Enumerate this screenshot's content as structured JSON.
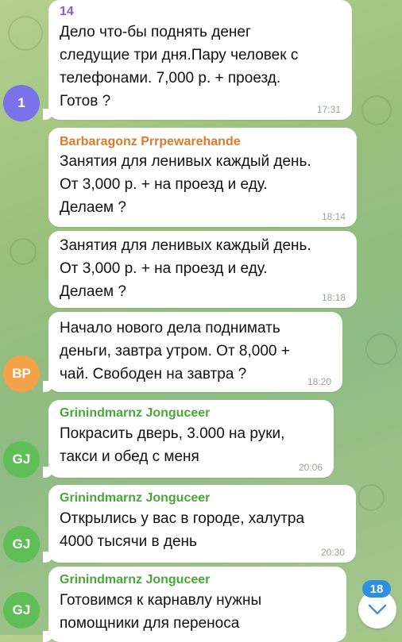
{
  "colors": {
    "sender_orange": "#d97b2a",
    "sender_green": "#4aa63a",
    "sender_purple": "#8e5cc9",
    "avatar_purple": "#7a72e8",
    "avatar_orange": "#f4a24a",
    "avatar_green": "#5fbe58",
    "badge_blue": "#2f8fe0"
  },
  "messages": [
    {
      "sender": "14",
      "text": "Дело что-бы поднять денег\nследущие три дня.Пару человек с\nтелефонами. 7,000 р. + проезд.\nГотов ?",
      "time": "17:31"
    },
    {
      "sender": "Barbaragonz Prrpewarehande",
      "text": "Занятия для ленивых каждый день.\nОт 3,000 р. + на проезд и еду.\nДелаем ?",
      "time": "18:14"
    },
    {
      "text": "Занятия для ленивых каждый день.\nОт 3,000 р. + на проезд и еду.\nДелаем ?",
      "time": "18:18"
    },
    {
      "text": "Начало нового дела поднимать\nденьги, завтра утром. От 8,000 +\nчай. Свободен на завтра ?",
      "time": "18:20"
    },
    {
      "sender": "Grinindmarnz Jonguceer",
      "text": "Покрасить дверь, 3.000 на руки,\nтакси и обед с меня",
      "time": "20:06"
    },
    {
      "sender": "Grinindmarnz Jonguceer",
      "text": "Открылись у вас в городе, халутра\n4000 тысячи в день",
      "time": "20:30"
    },
    {
      "sender": "Grinindmarnz Jonguceer",
      "text": "Готовимся к карнавлу нужны\nпомощники для переноса"
    }
  ],
  "avatars": [
    {
      "initials": "1"
    },
    {
      "initials": "BP"
    },
    {
      "initials": "GJ"
    },
    {
      "initials": "GJ"
    },
    {
      "initials": "GJ"
    }
  ],
  "scroll": {
    "unread_count": "18",
    "icon": "chevron-down-icon"
  }
}
